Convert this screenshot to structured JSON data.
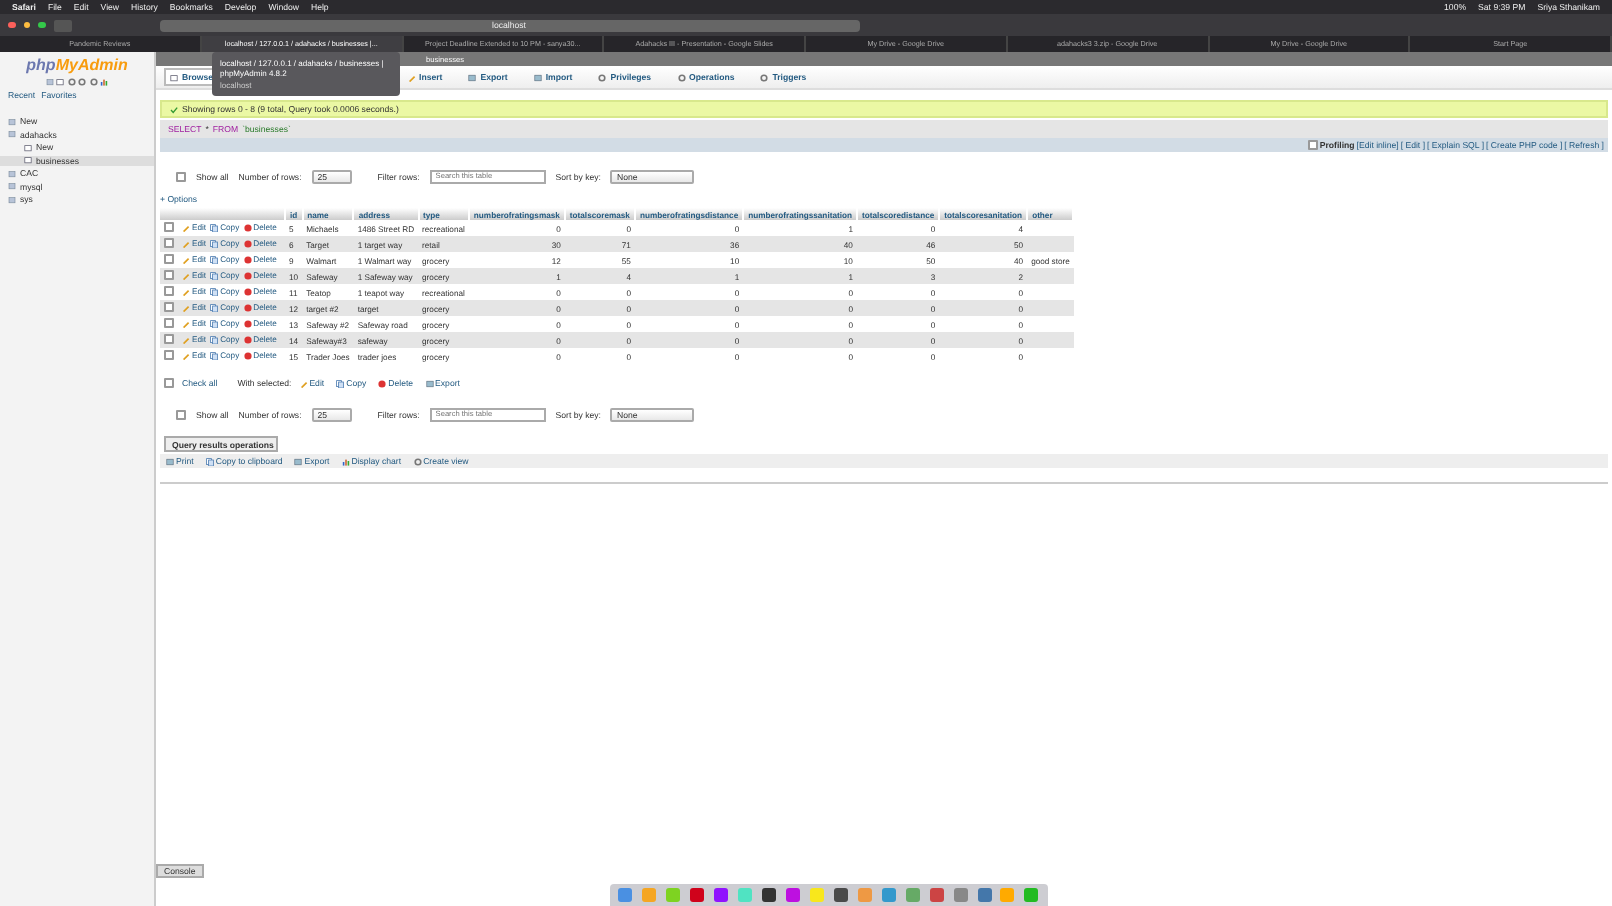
{
  "menubar": {
    "app": "Safari",
    "menus": [
      "File",
      "Edit",
      "View",
      "History",
      "Bookmarks",
      "Develop",
      "Window",
      "Help"
    ],
    "battery": "100%",
    "clock": "Sat 9:39 PM",
    "user": "Sriya Sthanikam"
  },
  "browser": {
    "url": "localhost",
    "tabs": [
      {
        "title": "Pandemic Reviews",
        "selected": false
      },
      {
        "title": "localhost / 127.0.0.1 / adahacks / businesses |...",
        "selected": true
      },
      {
        "title": "Project Deadline Extended to 10 PM - sanya30...",
        "selected": false
      },
      {
        "title": "Adahacks III - Presentation - Google Slides",
        "selected": false
      },
      {
        "title": "My Drive - Google Drive",
        "selected": false
      },
      {
        "title": "adahacks3 3.zip - Google Drive",
        "selected": false
      },
      {
        "title": "My Drive - Google Drive",
        "selected": false
      },
      {
        "title": "Start Page",
        "selected": false
      }
    ],
    "tooltip": {
      "title": "localhost / 127.0.0.1 / adahacks / businesses | phpMyAdmin 4.8.2",
      "subtitle": "localhost"
    }
  },
  "sidebar": {
    "logo_php": "php",
    "logo_admin": "MyAdmin",
    "links": [
      "Recent",
      "Favorites"
    ],
    "tree": [
      {
        "label": "New",
        "selected": false
      },
      {
        "label": "adahacks",
        "selected": false,
        "children": [
          {
            "label": "New",
            "selected": false
          },
          {
            "label": "businesses",
            "selected": true
          }
        ]
      },
      {
        "label": "CAC",
        "selected": false
      },
      {
        "label": "mysql",
        "selected": false
      },
      {
        "label": "sys",
        "selected": false
      }
    ]
  },
  "breadcrumb": "businesses",
  "tabs": [
    {
      "label": "Browse",
      "selected": true
    },
    {
      "label": "Insert",
      "selected": false
    },
    {
      "label": "Export",
      "selected": false
    },
    {
      "label": "Import",
      "selected": false
    },
    {
      "label": "Privileges",
      "selected": false
    },
    {
      "label": "Operations",
      "selected": false
    },
    {
      "label": "Triggers",
      "selected": false
    }
  ],
  "message": "Showing rows 0 - 8 (9 total, Query took 0.0006 seconds.)",
  "sql": {
    "keyword1": "SELECT",
    "star": "*",
    "keyword2": "FROM",
    "table": "`businesses`"
  },
  "profiling": {
    "label": "Profiling",
    "checked": false,
    "links": [
      "[Edit inline]",
      "[ Edit ]",
      "[ Explain SQL ]",
      "[ Create PHP code ]",
      "[ Refresh ]"
    ]
  },
  "controls_top": {
    "show_all": "Show all",
    "show_all_checked": false,
    "rows_label": "Number of rows:",
    "rows_value": "25",
    "filter_label": "Filter rows:",
    "filter_placeholder": "Search this table",
    "sort_label": "Sort by key:",
    "sort_value": "None"
  },
  "options_link": "+ Options",
  "table": {
    "columns": [
      "id",
      "name",
      "address",
      "type",
      "numberofratingsmask",
      "totalscoremask",
      "numberofratingsdistance",
      "numberofratingssanitation",
      "totalscoredistance",
      "totalscoresanitation",
      "other"
    ],
    "rows": [
      {
        "checked": false,
        "actions": [
          "Edit",
          "Copy",
          "Delete"
        ],
        "cells": [
          "5",
          "Michaels",
          "1486 Street RD",
          "recreational",
          "0",
          "0",
          "0",
          "1",
          "0",
          "4",
          ""
        ]
      },
      {
        "checked": false,
        "actions": [
          "Edit",
          "Copy",
          "Delete"
        ],
        "cells": [
          "6",
          "Target",
          "1 target way",
          "retail",
          "30",
          "71",
          "36",
          "40",
          "46",
          "50",
          ""
        ]
      },
      {
        "checked": false,
        "actions": [
          "Edit",
          "Copy",
          "Delete"
        ],
        "cells": [
          "9",
          "Walmart",
          "1 Walmart way",
          "grocery",
          "12",
          "55",
          "10",
          "10",
          "50",
          "40",
          "good store"
        ]
      },
      {
        "checked": false,
        "actions": [
          "Edit",
          "Copy",
          "Delete"
        ],
        "cells": [
          "10",
          "Safeway",
          "1 Safeway way",
          "grocery",
          "1",
          "4",
          "1",
          "1",
          "3",
          "2",
          ""
        ]
      },
      {
        "checked": false,
        "actions": [
          "Edit",
          "Copy",
          "Delete"
        ],
        "cells": [
          "11",
          "Teatop",
          "1 teapot way",
          "recreational",
          "0",
          "0",
          "0",
          "0",
          "0",
          "0",
          ""
        ]
      },
      {
        "checked": false,
        "actions": [
          "Edit",
          "Copy",
          "Delete"
        ],
        "cells": [
          "12",
          "target #2",
          "target",
          "grocery",
          "0",
          "0",
          "0",
          "0",
          "0",
          "0",
          ""
        ]
      },
      {
        "checked": false,
        "actions": [
          "Edit",
          "Copy",
          "Delete"
        ],
        "cells": [
          "13",
          "Safeway #2",
          "Safeway road",
          "grocery",
          "0",
          "0",
          "0",
          "0",
          "0",
          "0",
          ""
        ]
      },
      {
        "checked": false,
        "actions": [
          "Edit",
          "Copy",
          "Delete"
        ],
        "cells": [
          "14",
          "Safeway#3",
          "safeway",
          "grocery",
          "0",
          "0",
          "0",
          "0",
          "0",
          "0",
          ""
        ]
      },
      {
        "checked": false,
        "actions": [
          "Edit",
          "Copy",
          "Delete"
        ],
        "cells": [
          "15",
          "Trader Joes",
          "trader joes",
          "grocery",
          "0",
          "0",
          "0",
          "0",
          "0",
          "0",
          ""
        ]
      }
    ]
  },
  "bulk": {
    "check_all": "Check all",
    "checked": false,
    "with_selected": "With selected:",
    "actions": [
      "Edit",
      "Copy",
      "Delete",
      "Export"
    ]
  },
  "controls_bottom": {
    "show_all": "Show all",
    "show_all_checked": false,
    "rows_label": "Number of rows:",
    "rows_value": "25",
    "filter_label": "Filter rows:",
    "filter_placeholder": "Search this table",
    "sort_label": "Sort by key:",
    "sort_value": "None"
  },
  "operations": {
    "title": "Query results operations",
    "actions": [
      "Print",
      "Copy to clipboard",
      "Export",
      "Display chart",
      "Create view"
    ]
  },
  "console": "Console"
}
